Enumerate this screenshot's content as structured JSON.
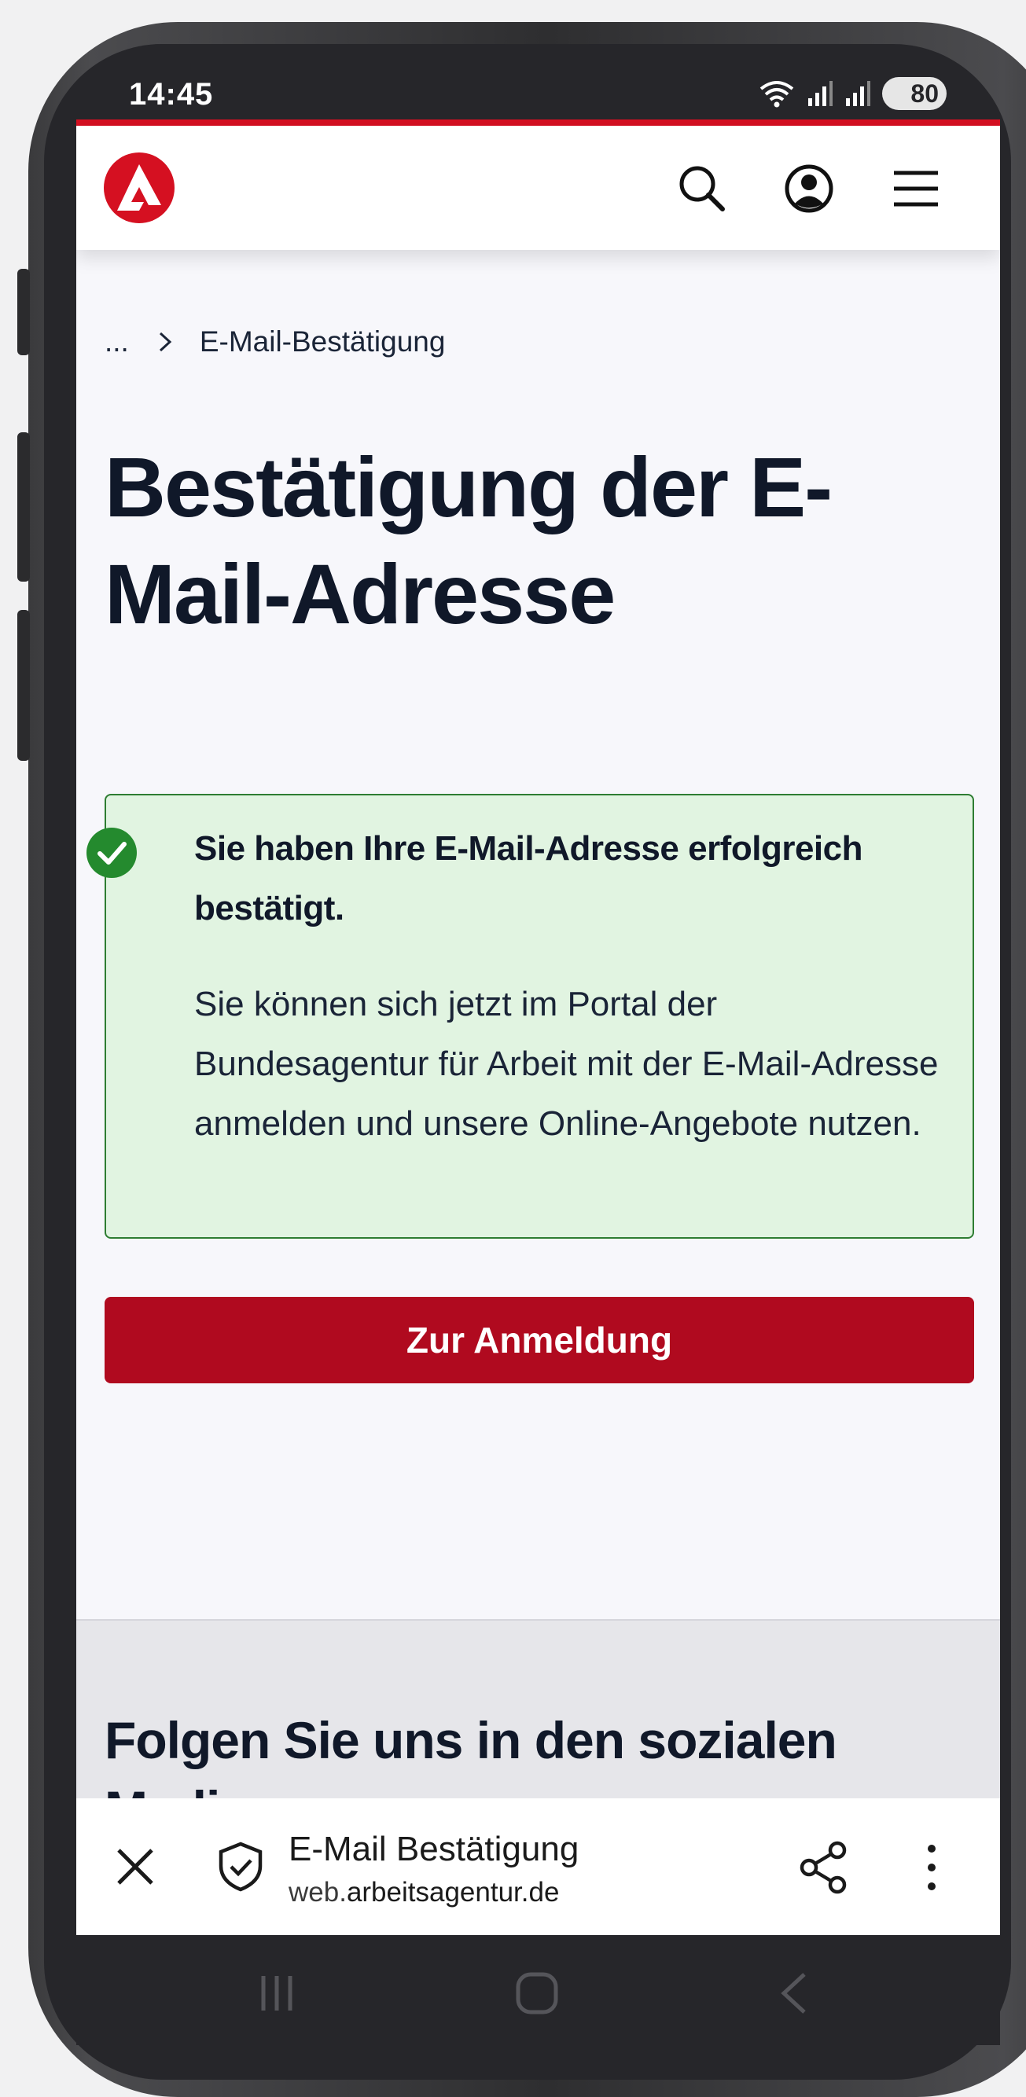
{
  "status_bar": {
    "time": "14:45",
    "battery": "80",
    "icons": [
      "wifi-icon",
      "signal-icon",
      "signal-icon",
      "battery-icon"
    ]
  },
  "header": {
    "logo": "arbeitsagentur-logo",
    "icons": [
      "search-icon",
      "account-icon",
      "menu-icon"
    ]
  },
  "breadcrumb": {
    "ellipsis": "...",
    "current": "E-Mail-Bestätigung"
  },
  "page": {
    "title": "Bestätigung der E-Mail-Adresse"
  },
  "success": {
    "heading": "Sie haben Ihre E-Mail-Adresse erfolgreich bestätigt.",
    "text": "Sie können sich jetzt im Portal der Bundesagentur für Arbeit mit der E-Mail-Adresse anmelden und unsere Online-Angebote nutzen."
  },
  "cta": {
    "label": "Zur Anmeldung"
  },
  "footer": {
    "heading": "Folgen Sie uns in den sozialen Medien"
  },
  "browser_bar": {
    "title": "E-Mail Bestätigung",
    "url_prefix": "web.",
    "url_domain": "arbeitsagentur.de"
  },
  "colors": {
    "brand_red": "#d51021",
    "button_red": "#b00a1f",
    "success_bg": "#e1f4e1",
    "success_border": "#2e7d32",
    "heading": "#101829"
  }
}
